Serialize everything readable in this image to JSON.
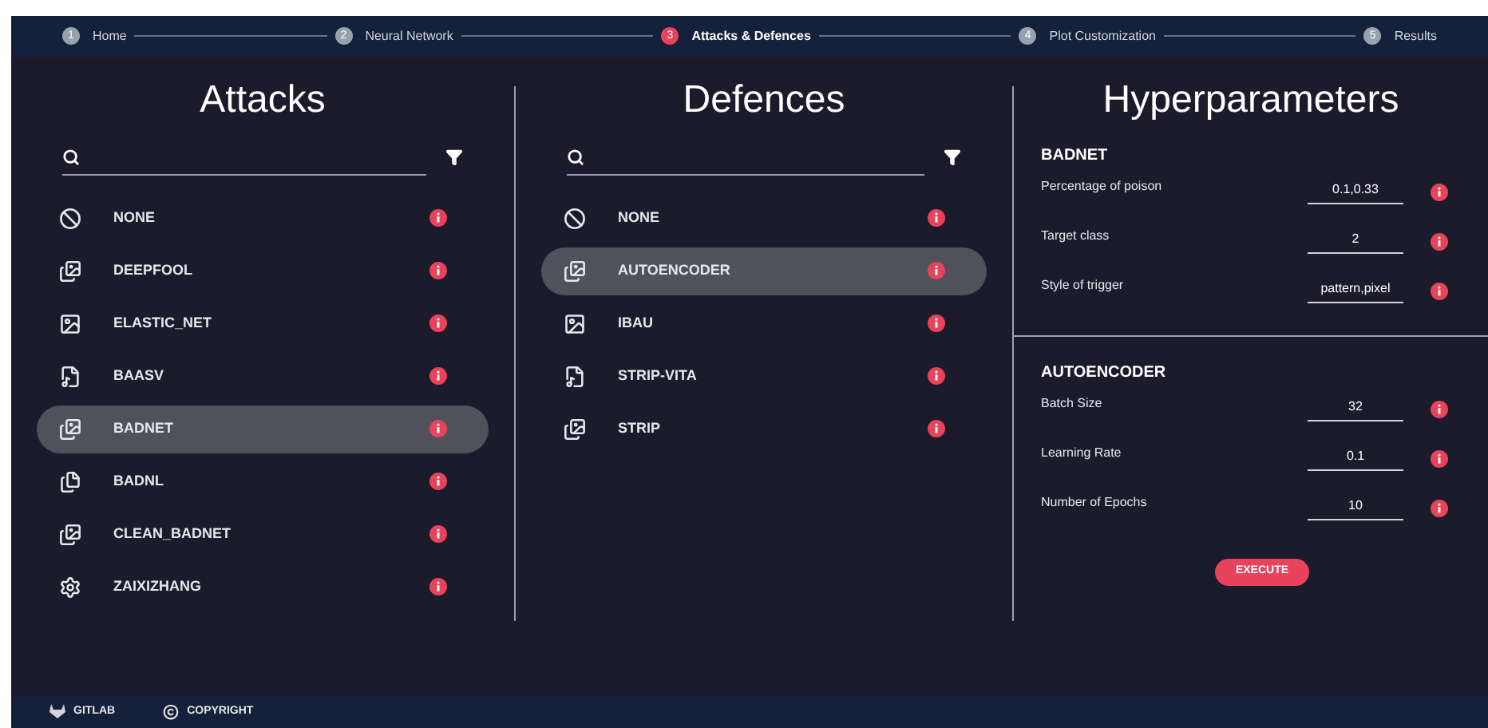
{
  "steps": [
    {
      "number": "1",
      "label": "Home",
      "active": false
    },
    {
      "number": "2",
      "label": "Neural Network",
      "active": false
    },
    {
      "number": "3",
      "label": "Attacks & Defences",
      "active": true
    },
    {
      "number": "4",
      "label": "Plot Customization",
      "active": false
    },
    {
      "number": "5",
      "label": "Results",
      "active": false
    }
  ],
  "attacks": {
    "title": "Attacks",
    "items": [
      {
        "label": "NONE",
        "kind": "none",
        "selected": false
      },
      {
        "label": "DEEPFOOL",
        "kind": "images",
        "selected": false
      },
      {
        "label": "ELASTIC_NET",
        "kind": "image",
        "selected": false
      },
      {
        "label": "BAASV",
        "kind": "music",
        "selected": false
      },
      {
        "label": "BADNET",
        "kind": "images",
        "selected": true
      },
      {
        "label": "BADNL",
        "kind": "text",
        "selected": false
      },
      {
        "label": "CLEAN_BADNET",
        "kind": "images",
        "selected": false
      },
      {
        "label": "ZAIXIZHANG",
        "kind": "gear",
        "selected": false
      }
    ]
  },
  "defences": {
    "title": "Defences",
    "items": [
      {
        "label": "NONE",
        "kind": "none",
        "selected": false
      },
      {
        "label": "AUTOENCODER",
        "kind": "images",
        "selected": true
      },
      {
        "label": "IBAU",
        "kind": "image",
        "selected": false
      },
      {
        "label": "STRIP-VITA",
        "kind": "music",
        "selected": false
      },
      {
        "label": "STRIP",
        "kind": "images",
        "selected": false
      }
    ]
  },
  "hyperparameters": {
    "title": "Hyperparameters",
    "sections": [
      {
        "heading": "BADNET",
        "fields": [
          {
            "label": "Percentage of poison",
            "value": "0.1,0.33"
          },
          {
            "label": "Target class",
            "value": "2"
          },
          {
            "label": "Style of trigger",
            "value": "pattern,pixel"
          }
        ]
      },
      {
        "heading": "AUTOENCODER",
        "fields": [
          {
            "label": "Batch Size",
            "value": "32"
          },
          {
            "label": "Learning Rate",
            "value": "0.1"
          },
          {
            "label": "Number of Epochs",
            "value": "10"
          }
        ]
      }
    ],
    "button": "EXECUTE"
  },
  "footer": [
    {
      "label": "GITLAB",
      "kind": "gitlab"
    },
    {
      "label": "COPYRIGHT",
      "kind": "copyright"
    }
  ]
}
